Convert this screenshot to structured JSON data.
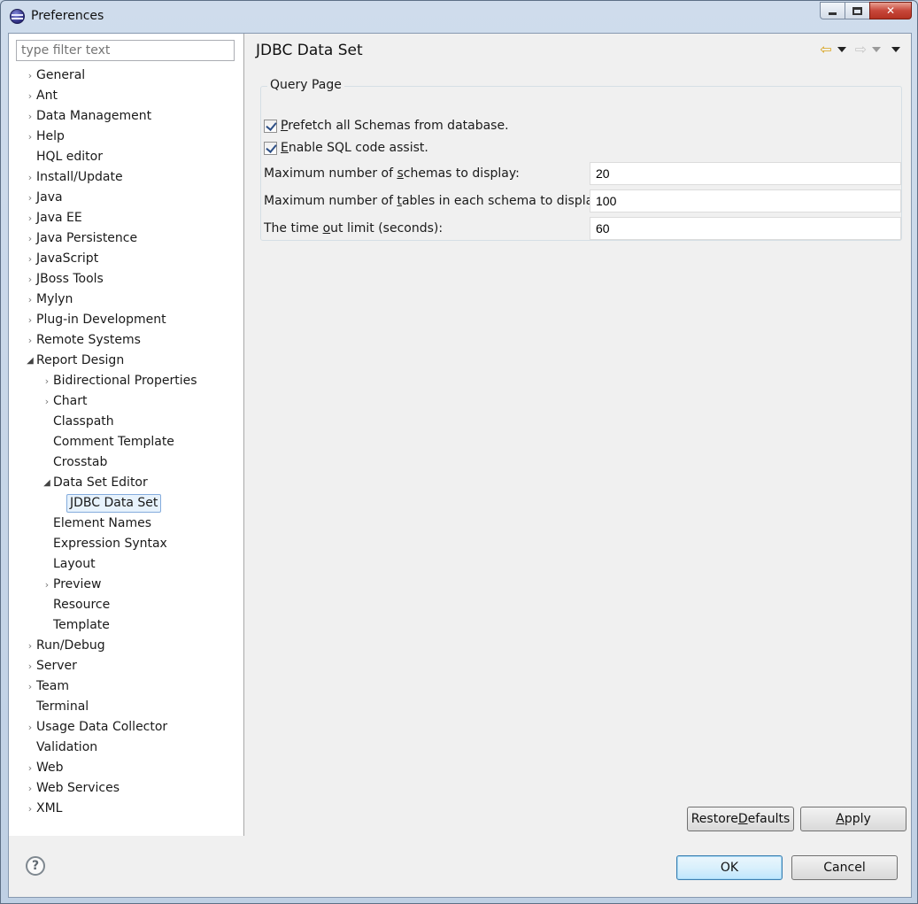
{
  "window": {
    "title": "Preferences"
  },
  "filter": {
    "placeholder": "type filter text"
  },
  "tree": {
    "items": [
      {
        "label": "General",
        "level": 0,
        "arrow": "closed"
      },
      {
        "label": "Ant",
        "level": 0,
        "arrow": "closed"
      },
      {
        "label": "Data Management",
        "level": 0,
        "arrow": "closed"
      },
      {
        "label": "Help",
        "level": 0,
        "arrow": "closed"
      },
      {
        "label": "HQL editor",
        "level": 0,
        "arrow": "none"
      },
      {
        "label": "Install/Update",
        "level": 0,
        "arrow": "closed"
      },
      {
        "label": "Java",
        "level": 0,
        "arrow": "closed"
      },
      {
        "label": "Java EE",
        "level": 0,
        "arrow": "closed"
      },
      {
        "label": "Java Persistence",
        "level": 0,
        "arrow": "closed"
      },
      {
        "label": "JavaScript",
        "level": 0,
        "arrow": "closed"
      },
      {
        "label": "JBoss Tools",
        "level": 0,
        "arrow": "closed"
      },
      {
        "label": "Mylyn",
        "level": 0,
        "arrow": "closed"
      },
      {
        "label": "Plug-in Development",
        "level": 0,
        "arrow": "closed"
      },
      {
        "label": "Remote Systems",
        "level": 0,
        "arrow": "closed"
      },
      {
        "label": "Report Design",
        "level": 0,
        "arrow": "open"
      },
      {
        "label": "Bidirectional Properties",
        "level": 1,
        "arrow": "closed"
      },
      {
        "label": "Chart",
        "level": 1,
        "arrow": "closed"
      },
      {
        "label": "Classpath",
        "level": 1,
        "arrow": "none"
      },
      {
        "label": "Comment Template",
        "level": 1,
        "arrow": "none"
      },
      {
        "label": "Crosstab",
        "level": 1,
        "arrow": "none"
      },
      {
        "label": "Data Set Editor",
        "level": 1,
        "arrow": "open"
      },
      {
        "label": "JDBC Data Set",
        "level": 2,
        "arrow": "none",
        "selected": true
      },
      {
        "label": "Element Names",
        "level": 1,
        "arrow": "none"
      },
      {
        "label": "Expression Syntax",
        "level": 1,
        "arrow": "none"
      },
      {
        "label": "Layout",
        "level": 1,
        "arrow": "none"
      },
      {
        "label": "Preview",
        "level": 1,
        "arrow": "closed"
      },
      {
        "label": "Resource",
        "level": 1,
        "arrow": "none"
      },
      {
        "label": "Template",
        "level": 1,
        "arrow": "none"
      },
      {
        "label": "Run/Debug",
        "level": 0,
        "arrow": "closed"
      },
      {
        "label": "Server",
        "level": 0,
        "arrow": "closed"
      },
      {
        "label": "Team",
        "level": 0,
        "arrow": "closed"
      },
      {
        "label": "Terminal",
        "level": 0,
        "arrow": "none"
      },
      {
        "label": "Usage Data Collector",
        "level": 0,
        "arrow": "closed"
      },
      {
        "label": "Validation",
        "level": 0,
        "arrow": "none"
      },
      {
        "label": "Web",
        "level": 0,
        "arrow": "closed"
      },
      {
        "label": "Web Services",
        "level": 0,
        "arrow": "closed"
      },
      {
        "label": "XML",
        "level": 0,
        "arrow": "closed"
      }
    ]
  },
  "page": {
    "title": "JDBC Data Set",
    "group_title": "Query Page",
    "prefetch": {
      "pre": "",
      "mnemonic": "P",
      "post": "refetch all Schemas from database.",
      "checked": true
    },
    "sql_assist": {
      "pre": "",
      "mnemonic": "E",
      "post": "nable SQL code assist.",
      "checked": true
    },
    "max_schemas": {
      "pre": "Maximum number of ",
      "mnemonic": "s",
      "post": "chemas to display:",
      "value": "20"
    },
    "max_tables": {
      "pre": "Maximum number of ",
      "mnemonic": "t",
      "post": "ables in each schema to display:",
      "value": "100"
    },
    "timeout": {
      "pre": "The time ",
      "mnemonic": "o",
      "post": "ut limit (seconds):",
      "value": "60"
    }
  },
  "buttons": {
    "restore_pre": "Restore ",
    "restore_mn": "D",
    "restore_post": "efaults",
    "apply_mn": "A",
    "apply_post": "pply",
    "ok": "OK",
    "cancel": "Cancel",
    "help": "?"
  },
  "icons": {
    "back": "back-arrow-icon",
    "forward": "forward-arrow-icon",
    "menu": "view-menu-icon",
    "accent_back": "#d9a21a"
  }
}
